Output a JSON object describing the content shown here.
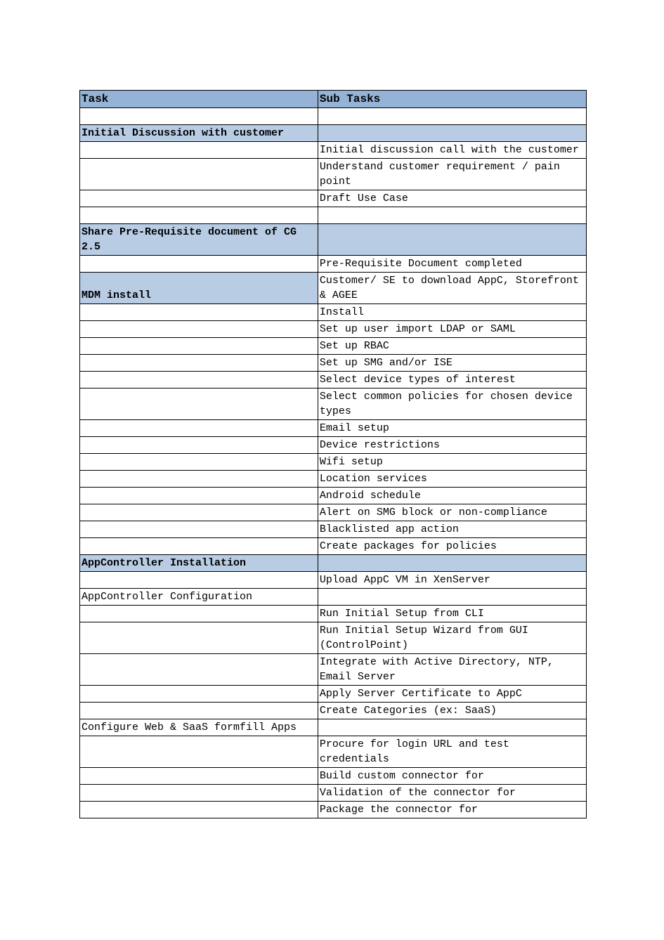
{
  "headers": {
    "task": "Task",
    "sub": "Sub Tasks"
  },
  "rows": [
    {
      "type": "spacer"
    },
    {
      "type": "section",
      "task": "Initial Discussion with customer",
      "sub": ""
    },
    {
      "type": "item",
      "task": "",
      "sub": "Initial discussion call with the customer"
    },
    {
      "type": "item",
      "task": "",
      "sub": "Understand customer requirement / pain point"
    },
    {
      "type": "item",
      "task": "",
      "sub": "Draft Use Case"
    },
    {
      "type": "spacer"
    },
    {
      "type": "section",
      "task": "Share Pre-Requisite document of CG 2.5",
      "sub": ""
    },
    {
      "type": "item",
      "task": "",
      "sub": "Pre-Requisite Document completed"
    },
    {
      "type": "mdm",
      "task": "MDM install",
      "sub": "Customer/ SE to download AppC, Storefront & AGEE"
    },
    {
      "type": "item",
      "task": "",
      "sub": "Install"
    },
    {
      "type": "item",
      "task": "",
      "sub": "Set up user import LDAP or SAML"
    },
    {
      "type": "item",
      "task": "",
      "sub": "Set up RBAC"
    },
    {
      "type": "item",
      "task": "",
      "sub": "Set up SMG and/or ISE"
    },
    {
      "type": "item",
      "task": "",
      "sub": "Select device types of interest"
    },
    {
      "type": "item",
      "task": "",
      "sub": "Select common policies for chosen device types"
    },
    {
      "type": "item",
      "task": "",
      "sub": "Email setup"
    },
    {
      "type": "item",
      "task": "",
      "sub": "Device restrictions"
    },
    {
      "type": "item",
      "task": "",
      "sub": "Wifi setup"
    },
    {
      "type": "item",
      "task": "",
      "sub": "Location services"
    },
    {
      "type": "item",
      "task": "",
      "sub": "Android schedule"
    },
    {
      "type": "item",
      "task": "",
      "sub": "Alert on SMG block or non-compliance"
    },
    {
      "type": "item",
      "task": "",
      "sub": "Blacklisted app action"
    },
    {
      "type": "item",
      "task": "",
      "sub": "Create packages for policies"
    },
    {
      "type": "section",
      "task": "AppController Installation",
      "sub": ""
    },
    {
      "type": "item",
      "task": "",
      "sub": "Upload AppC VM in XenServer"
    },
    {
      "type": "plain",
      "task": "AppController Configuration",
      "sub": ""
    },
    {
      "type": "item",
      "task": "",
      "sub": "Run Initial Setup from CLI"
    },
    {
      "type": "item",
      "task": "",
      "sub": "Run Initial Setup Wizard from GUI (ControlPoint)"
    },
    {
      "type": "item",
      "task": "",
      "sub": "Integrate with Active Directory, NTP, Email Server"
    },
    {
      "type": "item",
      "task": "",
      "sub": "Apply Server Certificate to AppC"
    },
    {
      "type": "item",
      "task": "",
      "sub": "Create Categories (ex: SaaS)"
    },
    {
      "type": "plain",
      "task": "Configure Web & SaaS formfill Apps",
      "sub": ""
    },
    {
      "type": "item",
      "task": "",
      "sub": "Procure for  login URL and test credentials"
    },
    {
      "type": "item",
      "task": "",
      "sub": "Build custom connector for"
    },
    {
      "type": "item",
      "task": "",
      "sub": "Validation of the connector for"
    },
    {
      "type": "item",
      "task": "",
      "sub": "Package the connector for"
    }
  ]
}
